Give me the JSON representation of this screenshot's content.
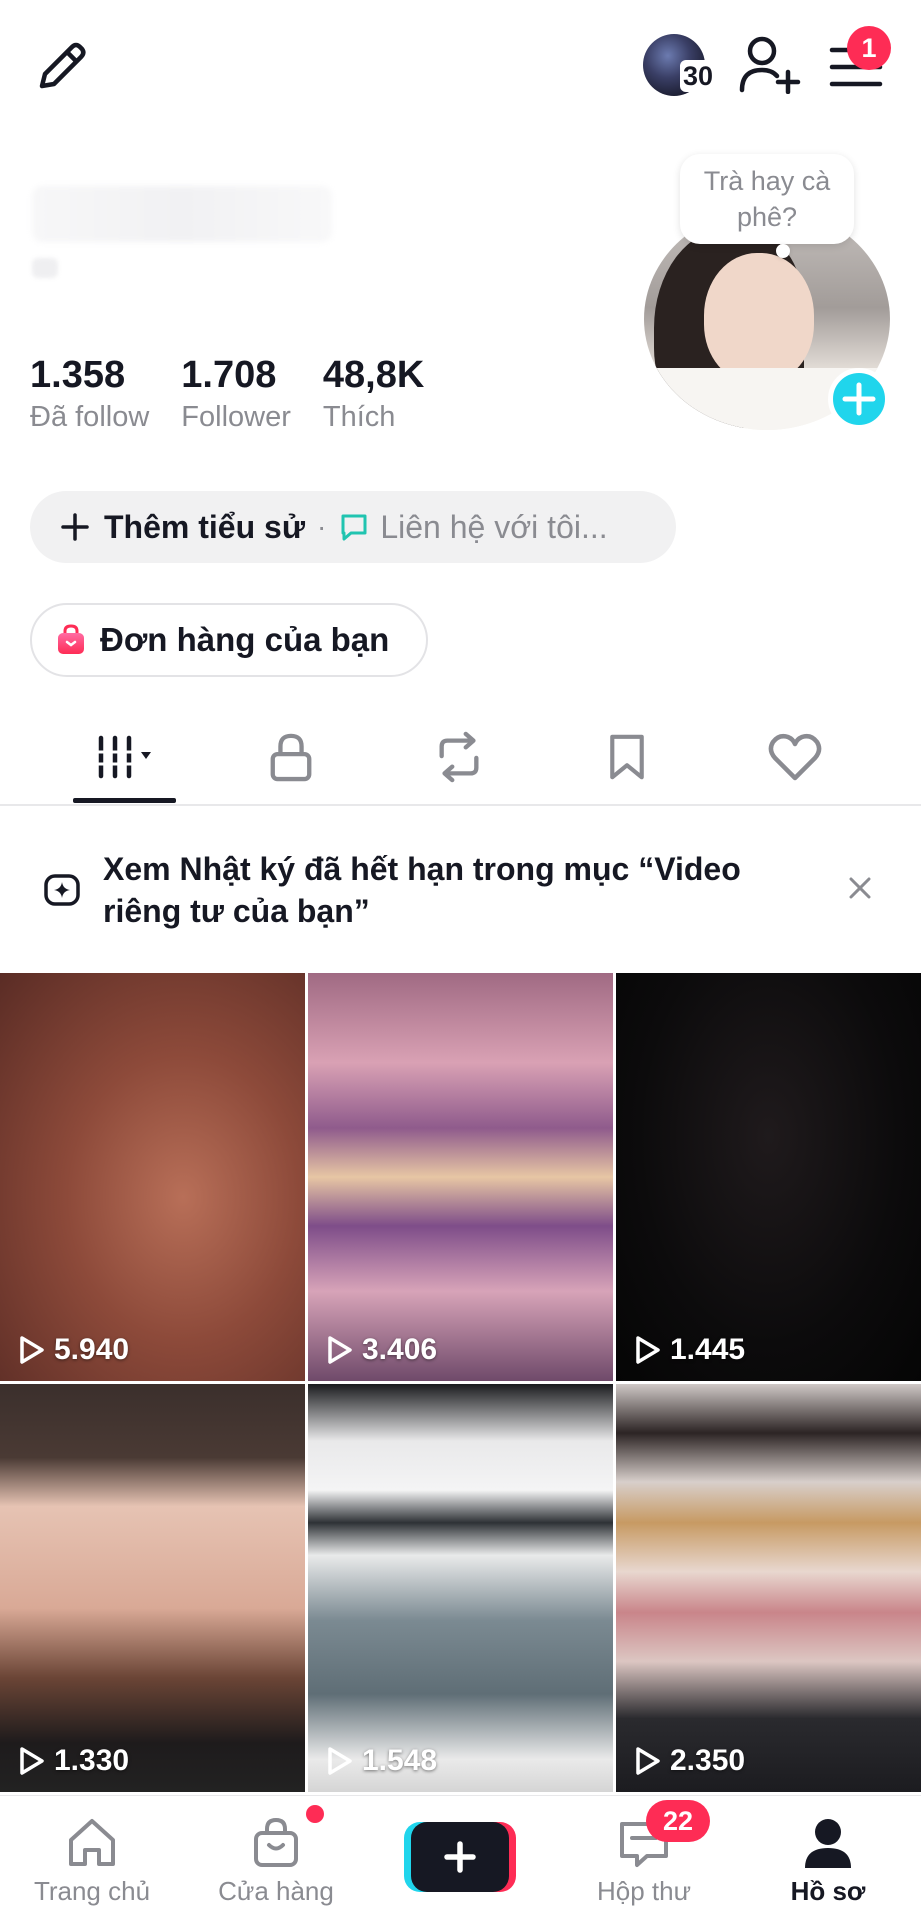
{
  "header": {
    "story_count": "30",
    "menu_badge": "1",
    "profile_note": "Trà hay cà phê?"
  },
  "stats": [
    {
      "value": "1.358",
      "label": "Đã follow"
    },
    {
      "value": "1.708",
      "label": "Follower"
    },
    {
      "value": "48,8K",
      "label": "Thích"
    }
  ],
  "bio": {
    "add_bio_label": "Thêm tiểu sử",
    "separator": "·",
    "contact_placeholder": "Liên hệ với tôi..."
  },
  "orders": {
    "label": "Đơn hàng của bạn"
  },
  "tabs": [
    "videos-grid",
    "private",
    "reposts",
    "favorites",
    "liked"
  ],
  "banner": {
    "text": "Xem Nhật ký đã hết hạn trong mục “Video riêng tư của bạn”"
  },
  "videos": [
    {
      "views": "5.940"
    },
    {
      "views": "3.406"
    },
    {
      "views": "1.445"
    },
    {
      "views": "1.330"
    },
    {
      "views": "1.548"
    },
    {
      "views": "2.350"
    }
  ],
  "bottom_nav": {
    "home": "Trang chủ",
    "shop": "Cửa hàng",
    "inbox": "Hộp thư",
    "inbox_badge": "22",
    "profile": "Hồ sơ"
  },
  "colors": {
    "accent_red": "#fe2c55",
    "accent_cyan": "#20d5ec",
    "text_primary": "#161823",
    "text_secondary": "#8a8b91"
  }
}
